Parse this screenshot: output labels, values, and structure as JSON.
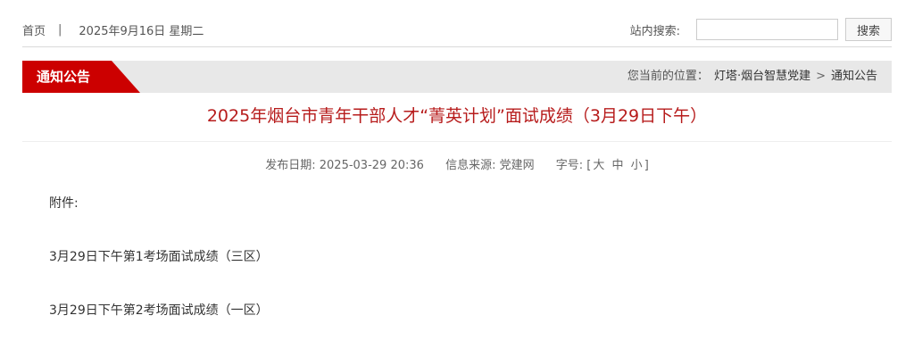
{
  "topbar": {
    "home": "首页",
    "separator": "|",
    "date": "2025年9月16日 星期二",
    "search_label": "站内搜索:",
    "search_value": "",
    "search_button": "搜索"
  },
  "section": {
    "title": "通知公告",
    "location_label": "您当前的位置：",
    "crumbs": [
      "灯塔·烟台智慧党建",
      "通知公告"
    ],
    "arrow": ">"
  },
  "article": {
    "title": "2025年烟台市青年干部人才“菁英计划”面试成绩（3月29日下午）",
    "publish_label": "发布日期:",
    "publish_date": "2025-03-29 20:36",
    "source_label": "信息来源:",
    "source": "党建网",
    "font_size_label": "字号:",
    "size_open": "[",
    "size_large": "大",
    "size_medium": "中",
    "size_small": "小",
    "size_close": "]",
    "attachment_label": "附件:",
    "attachments": [
      "3月29日下午第1考场面试成绩（三区）",
      "3月29日下午第2考场面试成绩（一区）"
    ]
  },
  "colors": {
    "accent_red": "#cc0000",
    "title_red": "#b71c1c",
    "section_bg": "#e8e8e8"
  }
}
